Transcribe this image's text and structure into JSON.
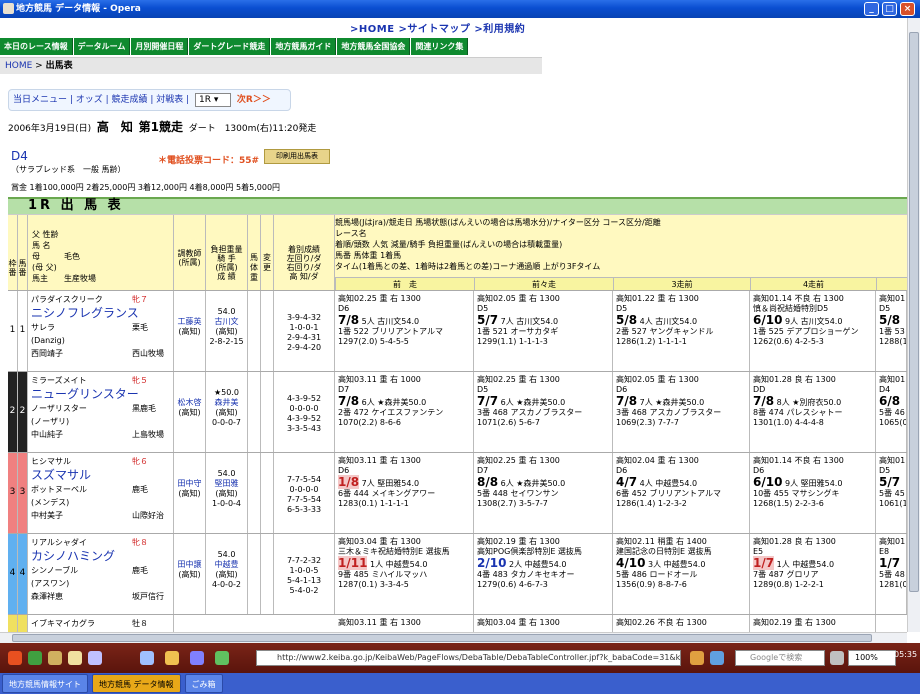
{
  "window": {
    "title": "地方競馬 データ情報 - Opera",
    "min": "_",
    "max": "□",
    "close": "×"
  },
  "toplinks": ">HOME  >サイトマップ  >利用規約",
  "nav": [
    "本日のレース情報",
    "データルーム",
    "月別開催日程",
    "ダートグレード競走",
    "地方競馬ガイド",
    "地方競馬全国協会",
    "関連リンク集"
  ],
  "breadcrumb": {
    "home": "HOME",
    "sep": " > ",
    "current": "出馬表"
  },
  "menu": {
    "links": "当日メニュー | オッズ | 競走成績 | 対戦表 |",
    "race_select": "1R",
    "next": "次R＞＞"
  },
  "race": {
    "date": "2006年3月19日(日)",
    "venue": "高　知",
    "race_no": "第1競走",
    "course": "ダート　1300m(右)11:20発走"
  },
  "grade": "D4",
  "race_class": "（サラブレッド系　一般 馬齢）",
  "tel": "＊電話投票コード：55#",
  "print_label": "印刷用出馬表",
  "prize": "賞金  1着100,000円  2着25,000円  3着12,000円  4着8,000円  5着5,000円",
  "table_title": "1R 出 馬 表",
  "header": {
    "waku": "枠番",
    "uma": "馬番",
    "horse_col": "父 性齢\n馬 名\n母　　　毛色\n(母 父)\n馬主　　生産牧場",
    "trainer": "調教師\n(所属)",
    "weight": "負担重量\n騎 手\n(所属)\n成 績",
    "bw": "馬体重",
    "chg": "変更",
    "record": "着別成績\n左回り/ダ\n右回り/ダ\n高 知/ダ",
    "legend": [
      "競馬場(Jはjra)/競走日 馬場状態(ばんえいの場合は馬場水分)/ナイター区分 コース区分/距離",
      "レース名",
      "着順/頭数 人気 減量/騎手 負担重量(ばんえいの場合は積載重量)",
      "馬番 馬体重 1着馬",
      "タイム(1着馬との差、1着時は2着馬との差)コーナ通過順 上がり3Fタイム"
    ],
    "cols": [
      "前　走",
      "前々走",
      "3走前",
      "4走前"
    ]
  },
  "rows": [
    {
      "waku": "1",
      "uma": "1",
      "color": "#ffffff",
      "sire": "パラダイスクリーク",
      "sexage": "牝７",
      "name": "ニシノフレグランス",
      "dam": "サレラ",
      "coat": "栗毛",
      "damsire": "(Danzig)",
      "owner": "西岡靖子",
      "breeder": "西山牧場",
      "trainer": "工藤英",
      "tloc": "(高知)",
      "wt": "54.0",
      "jockey": "古川文",
      "jloc": "(高知)",
      "jrec": "2-8-2-15",
      "rec": [
        "3-9-4-32",
        "1-0-0-1",
        "2-9-4-31",
        "2-9-4-20"
      ],
      "past": [
        [
          "高知02.25 重 右 1300",
          "D6",
          "7/8",
          "5人 古川文54.0",
          "1番 522 ブリリアントアルマ",
          "1297(2.0)  5-4-5-5"
        ],
        [
          "高知02.05 重 右 1300",
          "D5",
          "5/7",
          "7人 古川文54.0",
          "1番 521 オーサカタギ",
          "1299(1.1)  1-1-1-3"
        ],
        [
          "高知01.22 重 右 1300",
          "D5",
          "5/8",
          "4人 古川文54.0",
          "2番 527 ヤングキャンドル",
          "1286(1.2)  1-1-1-1"
        ],
        [
          "高知01.14 不良 右 1300",
          "慎＆尚祝結婚特別D5",
          "6/10",
          "9人 古川文54.0",
          "1番 525 デアプロショーゲン",
          "1262(0.6)  4-2-5-3"
        ]
      ]
    },
    {
      "waku": "2",
      "uma": "2",
      "color": "#222222",
      "sire": "ミラーズメイト",
      "sexage": "牝５",
      "name": "ニューグリンスター",
      "dam": "ノーザリスター",
      "coat": "黒鹿毛",
      "damsire": "(ノーザリ)",
      "owner": "中山純子",
      "breeder": "上島牧場",
      "trainer": "松木啓",
      "tloc": "(高知)",
      "wt": "★50.0",
      "jockey": "森井美",
      "jloc": "(高知)",
      "jrec": "0-0-0-7",
      "rec": [
        "4-3-9-52",
        "0-0-0-0",
        "4-3-9-52",
        "3-3-5-43"
      ],
      "past": [
        [
          "高知03.11 重 右 1000",
          "D7",
          "7/8",
          "6人 ★森井美50.0",
          "2番 472 ケイエスファンテン",
          "1070(2.2)  8-6-6"
        ],
        [
          "高知02.25 重 右 1300",
          "D5",
          "7/7",
          "6人 ★森井美50.0",
          "3番 468 アスカノブラスター",
          "1071(2.6)  5-6-7"
        ],
        [
          "高知02.05 重 右 1300",
          "D6",
          "7/8",
          "7人 ★森井美50.0",
          "3番 468 アスカノブラスター",
          "1069(2.3)  7-7-7"
        ],
        [
          "高知01.28 良 右 1300",
          "DD",
          "7/8",
          "8人 ★別府衣50.0",
          "8番 474 パレスシャトー",
          "1301(1.0)  4-4-4-8"
        ]
      ]
    },
    {
      "waku": "3",
      "uma": "3",
      "color": "#f08080",
      "sire": "ヒシマサル",
      "sexage": "牝６",
      "name": "スズマサル",
      "dam": "ボットヌーベル",
      "coat": "鹿毛",
      "damsire": "(メンデス)",
      "owner": "中村美子",
      "breeder": "山際好治",
      "trainer": "田中守",
      "tloc": "(高知)",
      "wt": "54.0",
      "jockey": "堅田雅",
      "jloc": "(高知)",
      "jrec": "1-0-0-4",
      "rec": [
        "7-7-5-54",
        "0-0-0-0",
        "7-7-5-54",
        "6-5-3-33"
      ],
      "past": [
        [
          "高知03.11 重 右 1300",
          "D6",
          "1/8",
          "7人 堅田雅54.0",
          "6番 444 メイキングアワー",
          "1283(0.1)  1-1-1-1"
        ],
        [
          "高知02.25 重 右 1300",
          "D7",
          "8/8",
          "6人 ★森井美50.0",
          "5番 448 セイワンサン",
          "1308(2.7)  3-5-7-7"
        ],
        [
          "高知02.04 重 右 1300",
          "D6",
          "4/7",
          "4人 中越豊54.0",
          "6番 452 ブリリアントアルマ",
          "1286(1.4)  1-2-3-2"
        ],
        [
          "高知01.14 不良 右 1300",
          "D6",
          "6/10",
          "9人 堅田雅54.0",
          "10番 455 マサシングキ",
          "1268(1.5)  2-2-3-6"
        ]
      ]
    },
    {
      "waku": "4",
      "uma": "4",
      "color": "#60b0f0",
      "sire": "リアルシャダイ",
      "sexage": "牝８",
      "name": "カシノハミング",
      "dam": "シンノーブル",
      "coat": "鹿毛",
      "damsire": "(アスワン)",
      "owner": "森澤祥恵",
      "breeder": "坂戸信行",
      "trainer": "田中譲",
      "tloc": "(高知)",
      "wt": "54.0",
      "jockey": "中越豊",
      "jloc": "(高知)",
      "jrec": "4-0-0-2",
      "rec": [
        "7-7-2-32",
        "1-0-0-5",
        "5-4-1-13",
        "5-4-0-2"
      ],
      "past": [
        [
          "高知03.04 重 右 1300",
          "三木＆ミキ祝結婚特別E 選抜馬",
          "1/11",
          "1人 中越豊54.0",
          "9番 485 ミハイルマッハ",
          "1287(0.1)  3-3-4-5"
        ],
        [
          "高知02.19 重 右 1300",
          "高知POG倶楽部特別E 選抜馬",
          "2/10",
          "2人 中越豊54.0",
          "4番 483 タカノキセキオー",
          "1279(0.6)  4-6-7-3"
        ],
        [
          "高知02.11 稍重 右 1400",
          "建国記念の日特別E 選抜馬",
          "4/10",
          "3人 中越豊54.0",
          "5番 486 ロードオール",
          "1356(0.9)  8-8-7-6"
        ],
        [
          "高知01.28 良 右 1300",
          "E5",
          "1/7",
          "1人 中越豊54.0",
          "7番 487 グロリア",
          "1289(0.8)  1-2-2-1"
        ]
      ]
    }
  ],
  "row5": {
    "sire": "イブキマイカグラ",
    "sexage": "牡８",
    "past": [
      "高知03.11 重 右 1300",
      "高知03.04 重 右 1300",
      "高知02.26 不良 右 1300",
      "高知02.19 重 右 1300"
    ]
  },
  "partial": [
    "高知01",
    "D5",
    "5/8",
    "1番 53",
    "1288(1",
    "高知01",
    "D4",
    "6/8",
    "5番 46",
    "1065(0",
    "高知01",
    "D5",
    "5/7",
    "5番 45",
    "1061(1",
    "高知01",
    "E8",
    "1/7",
    "5番 48",
    "1281(0"
  ],
  "taskbar": {
    "url": "http://www2.keiba.go.jp/KeibaWeb/PageFlows/DebaTable/DebaTableController.jpf?k_babaCode=31&k_raceN",
    "search": "Googleで検索",
    "zoom": "100%",
    "time": "05:35",
    "tasks": [
      "地方競馬情報サイト",
      "地方競馬 データ情報",
      "ごみ箱"
    ]
  }
}
